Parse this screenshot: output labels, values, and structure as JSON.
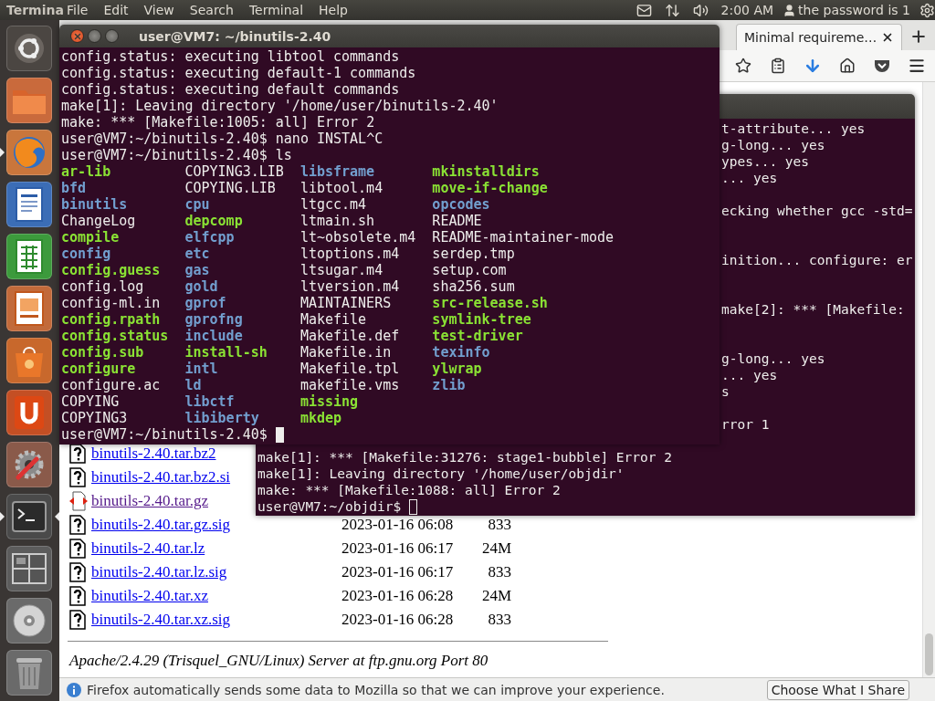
{
  "top_panel": {
    "app_name": "Termina",
    "menus": [
      "File",
      "Edit",
      "View",
      "Search",
      "Terminal",
      "Help"
    ],
    "clock": "2:00 AM",
    "user": "the password is 1"
  },
  "launcher": [
    {
      "kind": "dash",
      "running": false,
      "focused": false
    },
    {
      "kind": "files",
      "running": false,
      "focused": false
    },
    {
      "kind": "browser",
      "running": true,
      "focused": false
    },
    {
      "kind": "writer",
      "running": false,
      "focused": false
    },
    {
      "kind": "calc",
      "running": false,
      "focused": false
    },
    {
      "kind": "impress",
      "running": false,
      "focused": false
    },
    {
      "kind": "store",
      "running": false,
      "focused": false
    },
    {
      "kind": "cloud",
      "running": false,
      "focused": false
    },
    {
      "kind": "settings",
      "running": false,
      "focused": false
    },
    {
      "kind": "terminal",
      "running": true,
      "focused": true
    },
    {
      "kind": "workspaces",
      "running": false,
      "focused": false
    },
    {
      "kind": "disc",
      "running": false,
      "focused": false
    },
    {
      "kind": "trash",
      "running": false,
      "focused": false
    }
  ],
  "browser": {
    "tab": {
      "title": "Minimal requireme…",
      "selected": true
    },
    "files": [
      {
        "name": "binutils-2.40.tar.bz2",
        "kind": "unknown",
        "visited": false
      },
      {
        "name": "binutils-2.40.tar.bz2.si",
        "kind": "unknown",
        "visited": false
      },
      {
        "name": "binutils-2.40.tar.gz",
        "kind": "archive",
        "visited": true
      },
      {
        "name": "binutils-2.40.tar.gz.sig",
        "kind": "unknown",
        "visited": false,
        "date": "2023-01-16 06:08",
        "size": "833"
      },
      {
        "name": "binutils-2.40.tar.lz",
        "kind": "unknown",
        "visited": false,
        "date": "2023-01-16 06:17",
        "size": "24M"
      },
      {
        "name": "binutils-2.40.tar.lz.sig",
        "kind": "unknown",
        "visited": false,
        "date": "2023-01-16 06:17",
        "size": "833"
      },
      {
        "name": "binutils-2.40.tar.xz",
        "kind": "unknown",
        "visited": false,
        "date": "2023-01-16 06:28",
        "size": "24M"
      },
      {
        "name": "binutils-2.40.tar.xz.sig",
        "kind": "unknown",
        "visited": false,
        "date": "2023-01-16 06:28",
        "size": "833"
      }
    ],
    "server_line": "Apache/2.4.29 (Trisquel_GNU/Linux) Server at ftp.gnu.org Port 80",
    "notification": {
      "text": "Firefox automatically sends some data to Mozilla so that we can improve your experience.",
      "button": "Choose What I Share"
    }
  },
  "back_terminal": {
    "focused": false,
    "upper_blocks": [
      [
        "t-attribute... yes",
        "g-long... yes",
        "ypes... yes",
        "... yes"
      ],
      [
        "ecking whether gcc -std="
      ],
      [
        "inition... configure: er"
      ],
      [
        "make[2]: *** [Makefile:"
      ],
      [
        "g-long... yes",
        "... yes",
        "s"
      ],
      [
        "rror 1"
      ]
    ],
    "lines": [
      "make[1]: *** [Makefile:31276: stage1-bubble] Error 2",
      "make[1]: Leaving directory '/home/user/objdir'",
      "make: *** [Makefile:1088: all] Error 2"
    ],
    "prompt": "user@VM7:~/objdir$"
  },
  "front_terminal": {
    "title": "user@VM7: ~/binutils-2.40",
    "focused": true,
    "lines": [
      "config.status: executing libtool commands",
      "config.status: executing default-1 commands",
      "config.status: executing default commands",
      "make[1]: Leaving directory '/home/user/binutils-2.40'",
      "make: *** [Makefile:1005: all] Error 2",
      "user@VM7:~/binutils-2.40$ nano INSTAL^C",
      "user@VM7:~/binutils-2.40$ ls"
    ],
    "ls_columns": [
      [
        {
          "name": "ar-lib",
          "kind": "exec"
        },
        {
          "name": "bfd",
          "kind": "dir"
        },
        {
          "name": "binutils",
          "kind": "dir"
        },
        {
          "name": "ChangeLog",
          "kind": "file"
        },
        {
          "name": "compile",
          "kind": "exec"
        },
        {
          "name": "config",
          "kind": "dir"
        },
        {
          "name": "config.guess",
          "kind": "exec"
        },
        {
          "name": "config.log",
          "kind": "file"
        },
        {
          "name": "config-ml.in",
          "kind": "file"
        },
        {
          "name": "config.rpath",
          "kind": "exec"
        },
        {
          "name": "config.status",
          "kind": "exec"
        },
        {
          "name": "config.sub",
          "kind": "exec"
        },
        {
          "name": "configure",
          "kind": "exec"
        },
        {
          "name": "configure.ac",
          "kind": "file"
        },
        {
          "name": "COPYING",
          "kind": "file"
        },
        {
          "name": "COPYING3",
          "kind": "file"
        }
      ],
      [
        {
          "name": "COPYING3.LIB",
          "kind": "file"
        },
        {
          "name": "COPYING.LIB",
          "kind": "file"
        },
        {
          "name": "cpu",
          "kind": "dir"
        },
        {
          "name": "depcomp",
          "kind": "exec"
        },
        {
          "name": "elfcpp",
          "kind": "dir"
        },
        {
          "name": "etc",
          "kind": "dir"
        },
        {
          "name": "gas",
          "kind": "dir"
        },
        {
          "name": "gold",
          "kind": "dir"
        },
        {
          "name": "gprof",
          "kind": "dir"
        },
        {
          "name": "gprofng",
          "kind": "dir"
        },
        {
          "name": "include",
          "kind": "dir"
        },
        {
          "name": "install-sh",
          "kind": "exec"
        },
        {
          "name": "intl",
          "kind": "dir"
        },
        {
          "name": "ld",
          "kind": "dir"
        },
        {
          "name": "libctf",
          "kind": "dir"
        },
        {
          "name": "libiberty",
          "kind": "dir"
        }
      ],
      [
        {
          "name": "libsframe",
          "kind": "dir"
        },
        {
          "name": "libtool.m4",
          "kind": "file"
        },
        {
          "name": "ltgcc.m4",
          "kind": "file"
        },
        {
          "name": "ltmain.sh",
          "kind": "file"
        },
        {
          "name": "lt~obsolete.m4",
          "kind": "file"
        },
        {
          "name": "ltoptions.m4",
          "kind": "file"
        },
        {
          "name": "ltsugar.m4",
          "kind": "file"
        },
        {
          "name": "ltversion.m4",
          "kind": "file"
        },
        {
          "name": "MAINTAINERS",
          "kind": "file"
        },
        {
          "name": "Makefile",
          "kind": "file"
        },
        {
          "name": "Makefile.def",
          "kind": "file"
        },
        {
          "name": "Makefile.in",
          "kind": "file"
        },
        {
          "name": "Makefile.tpl",
          "kind": "file"
        },
        {
          "name": "makefile.vms",
          "kind": "file"
        },
        {
          "name": "missing",
          "kind": "exec"
        },
        {
          "name": "mkdep",
          "kind": "exec"
        }
      ],
      [
        {
          "name": "mkinstalldirs",
          "kind": "exec"
        },
        {
          "name": "move-if-change",
          "kind": "exec"
        },
        {
          "name": "opcodes",
          "kind": "dir"
        },
        {
          "name": "README",
          "kind": "file"
        },
        {
          "name": "README-maintainer-mode",
          "kind": "file"
        },
        {
          "name": "serdep.tmp",
          "kind": "file"
        },
        {
          "name": "setup.com",
          "kind": "file"
        },
        {
          "name": "sha256.sum",
          "kind": "file"
        },
        {
          "name": "src-release.sh",
          "kind": "exec"
        },
        {
          "name": "symlink-tree",
          "kind": "exec"
        },
        {
          "name": "test-driver",
          "kind": "exec"
        },
        {
          "name": "texinfo",
          "kind": "dir"
        },
        {
          "name": "ylwrap",
          "kind": "exec"
        },
        {
          "name": "zlib",
          "kind": "dir"
        }
      ]
    ],
    "prompt": "user@VM7:~/binutils-2.40$"
  }
}
